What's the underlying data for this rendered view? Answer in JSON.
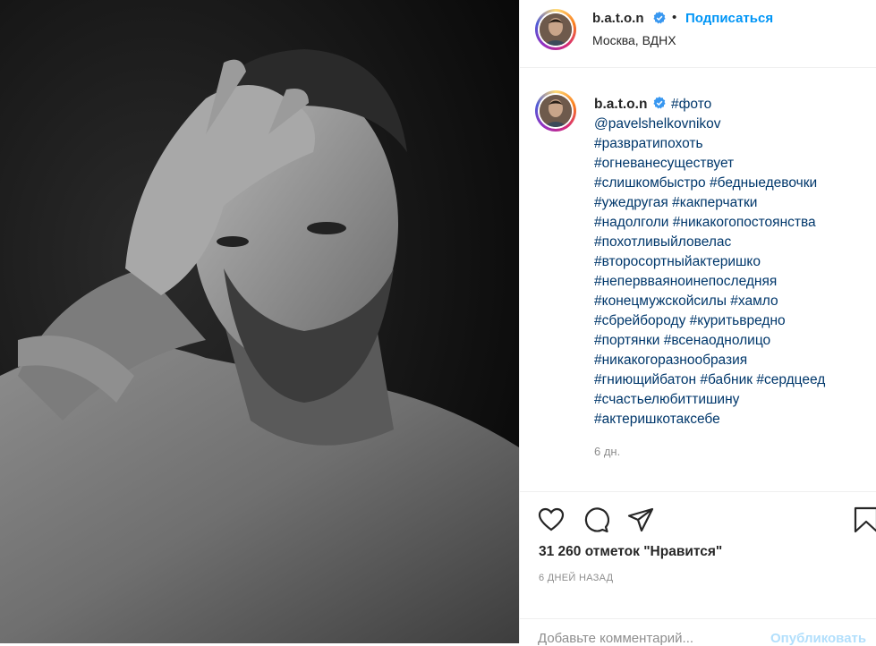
{
  "post": {
    "username": "b.a.t.o.n",
    "follow_label": "Подписаться",
    "separator": "•",
    "location": "Москва, ВДНХ",
    "caption_lines": [
      {
        "first": "#фото",
        "rest": ""
      },
      {
        "first": "@pavelshelkovnikov",
        "rest": ""
      },
      {
        "first": "#развратипохоть",
        "rest": ""
      },
      {
        "first": "#огневанесуществует",
        "rest": ""
      },
      {
        "first": "#слишкомбыстро",
        "rest": "#бедныедевочки"
      },
      {
        "first": "#ужедругая",
        "rest": "#какперчатки"
      },
      {
        "first": "#надолголи",
        "rest": "#никакогопостоянства"
      },
      {
        "first": "#похотливыйловелас",
        "rest": ""
      },
      {
        "first": "#второсортныйактеришко",
        "rest": ""
      },
      {
        "first": "#непервваяноинепоследняя",
        "rest": ""
      },
      {
        "first": "#конецмужскойсилы",
        "rest": "#хамло"
      },
      {
        "first": "#сбрейбороду",
        "rest": "#куритьвредно"
      },
      {
        "first": "#портянки",
        "rest": "#всенаоднолицо"
      },
      {
        "first": "#никакогоразнообразия",
        "rest": ""
      },
      {
        "first": "#гниющийбатон",
        "rest": "#бабник #сердцеед"
      },
      {
        "first": "#счастьелюбиттишину",
        "rest": ""
      },
      {
        "first": "#актеришкотаксебе",
        "rest": ""
      }
    ],
    "time_short": "6 дн.",
    "likes_text": "31 260 отметок \"Нравится\"",
    "time_long": "6 ДНЕЙ НАЗАД",
    "comment_placeholder": "Добавьте комментарий...",
    "publish_label": "Опубликовать"
  },
  "icons": {
    "like": "heart-icon",
    "comment": "speech-bubble-icon",
    "share": "paper-plane-icon",
    "save": "bookmark-icon",
    "verified": "verified-badge-icon"
  },
  "colors": {
    "link": "#00376b",
    "follow": "#0095f6",
    "muted": "#8e8e8e",
    "publish_disabled": "#b2dffc",
    "verified": "#3897f0"
  }
}
